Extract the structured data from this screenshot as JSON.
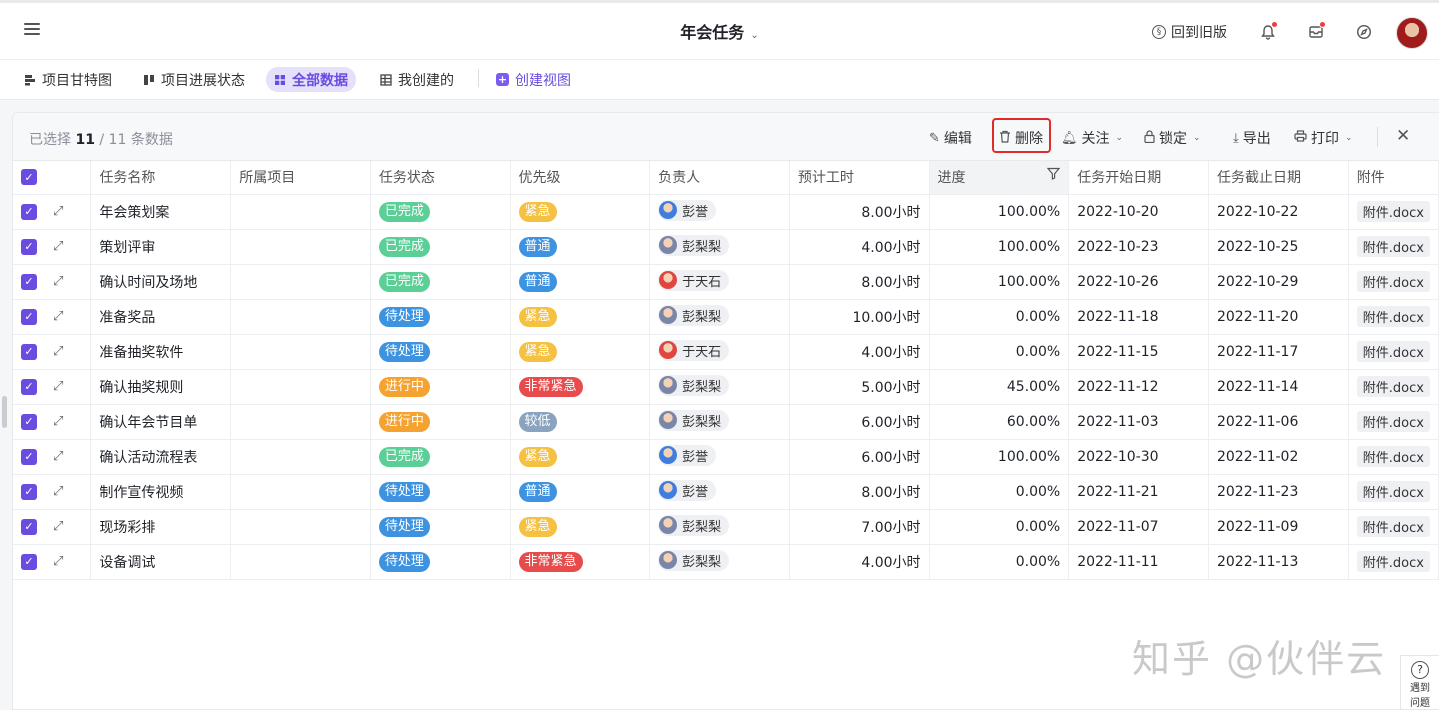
{
  "header": {
    "title": "年会任务",
    "back_to_old": "回到旧版"
  },
  "views": [
    {
      "label": "项目甘特图"
    },
    {
      "label": "项目进展状态"
    },
    {
      "label": "全部数据"
    },
    {
      "label": "我创建的"
    },
    {
      "label": "创建视图"
    }
  ],
  "toolbar": {
    "selected_prefix": "已选择 ",
    "selected_count": "11",
    "selected_suffix": " / 11 条数据",
    "edit": "编辑",
    "delete": "删除",
    "follow": "关注",
    "lock": "锁定",
    "export": "导出",
    "print": "打印"
  },
  "columns": [
    "任务名称",
    "所属项目",
    "任务状态",
    "优先级",
    "负责人",
    "预计工时",
    "进度",
    "任务开始日期",
    "任务截止日期",
    "附件"
  ],
  "rows": [
    {
      "name": "年会策划案",
      "project": "",
      "status": "已完成",
      "priority": "紧急",
      "owner": "彭誉",
      "hours": "8.00小时",
      "progress": "100.00%",
      "start": "2022-10-20",
      "end": "2022-10-22",
      "attach": "附件.docx"
    },
    {
      "name": "策划评审",
      "project": "",
      "status": "已完成",
      "priority": "普通",
      "owner": "彭梨梨",
      "hours": "4.00小时",
      "progress": "100.00%",
      "start": "2022-10-23",
      "end": "2022-10-25",
      "attach": "附件.docx"
    },
    {
      "name": "确认时间及场地",
      "project": "",
      "status": "已完成",
      "priority": "普通",
      "owner": "于天石",
      "hours": "8.00小时",
      "progress": "100.00%",
      "start": "2022-10-26",
      "end": "2022-10-29",
      "attach": "附件.docx"
    },
    {
      "name": "准备奖品",
      "project": "",
      "status": "待处理",
      "priority": "紧急",
      "owner": "彭梨梨",
      "hours": "10.00小时",
      "progress": "0.00%",
      "start": "2022-11-18",
      "end": "2022-11-20",
      "attach": "附件.docx"
    },
    {
      "name": "准备抽奖软件",
      "project": "",
      "status": "待处理",
      "priority": "紧急",
      "owner": "于天石",
      "hours": "4.00小时",
      "progress": "0.00%",
      "start": "2022-11-15",
      "end": "2022-11-17",
      "attach": "附件.docx"
    },
    {
      "name": "确认抽奖规则",
      "project": "",
      "status": "进行中",
      "priority": "非常紧急",
      "owner": "彭梨梨",
      "hours": "5.00小时",
      "progress": "45.00%",
      "start": "2022-11-12",
      "end": "2022-11-14",
      "attach": "附件.docx"
    },
    {
      "name": "确认年会节目单",
      "project": "",
      "status": "进行中",
      "priority": "较低",
      "owner": "彭梨梨",
      "hours": "6.00小时",
      "progress": "60.00%",
      "start": "2022-11-03",
      "end": "2022-11-06",
      "attach": "附件.docx"
    },
    {
      "name": "确认活动流程表",
      "project": "",
      "status": "已完成",
      "priority": "紧急",
      "owner": "彭誉",
      "hours": "6.00小时",
      "progress": "100.00%",
      "start": "2022-10-30",
      "end": "2022-11-02",
      "attach": "附件.docx"
    },
    {
      "name": "制作宣传视频",
      "project": "",
      "status": "待处理",
      "priority": "普通",
      "owner": "彭誉",
      "hours": "8.00小时",
      "progress": "0.00%",
      "start": "2022-11-21",
      "end": "2022-11-23",
      "attach": "附件.docx"
    },
    {
      "name": "现场彩排",
      "project": "",
      "status": "待处理",
      "priority": "紧急",
      "owner": "彭梨梨",
      "hours": "7.00小时",
      "progress": "0.00%",
      "start": "2022-11-07",
      "end": "2022-11-09",
      "attach": "附件.docx"
    },
    {
      "name": "设备调试",
      "project": "",
      "status": "待处理",
      "priority": "非常紧急",
      "owner": "彭梨梨",
      "hours": "4.00小时",
      "progress": "0.00%",
      "start": "2022-11-11",
      "end": "2022-11-13",
      "attach": "附件.docx"
    }
  ],
  "status_colors": {
    "已完成": "#5ccf97",
    "待处理": "#3e93e0",
    "进行中": "#f5a230"
  },
  "priority_colors": {
    "紧急": "#f5c142",
    "普通": "#3e93e0",
    "非常紧急": "#e84b4b",
    "较低": "#8aa3bf"
  },
  "owner_colors": {
    "彭誉": "#3f7de0",
    "彭梨梨": "#7a86a8",
    "于天石": "#e0453f"
  },
  "watermark": "知乎 @伙伴云",
  "help": {
    "line1": "遇到",
    "line2": "问题"
  }
}
